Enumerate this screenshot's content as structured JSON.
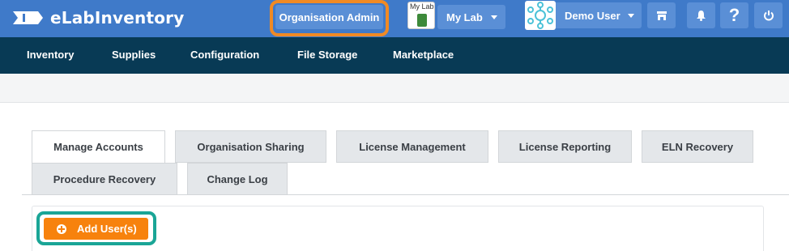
{
  "header": {
    "app_name": "eLabInventory",
    "org_admin_label": "Organisation Admin",
    "lab_thumb_text": "My Lab",
    "lab_label": "My Lab",
    "user_label": "Demo User",
    "icons": [
      "store-icon",
      "bell-icon",
      "help-icon",
      "power-icon"
    ],
    "brand_color": "#3f7ac9",
    "button_color": "#5a8fd6",
    "highlight_color": "#f08a24"
  },
  "nav": {
    "items": [
      "Inventory",
      "Supplies",
      "Configuration",
      "File Storage",
      "Marketplace"
    ],
    "color": "#083a55"
  },
  "tabs": {
    "items": [
      "Manage Accounts",
      "Organisation Sharing",
      "License Management",
      "License Reporting",
      "ELN Recovery",
      "Procedure Recovery",
      "Change Log"
    ],
    "active": "Manage Accounts"
  },
  "content": {
    "add_users_label": "Add User(s)",
    "add_button_color": "#f7820d",
    "highlight_color": "#1aa596"
  }
}
